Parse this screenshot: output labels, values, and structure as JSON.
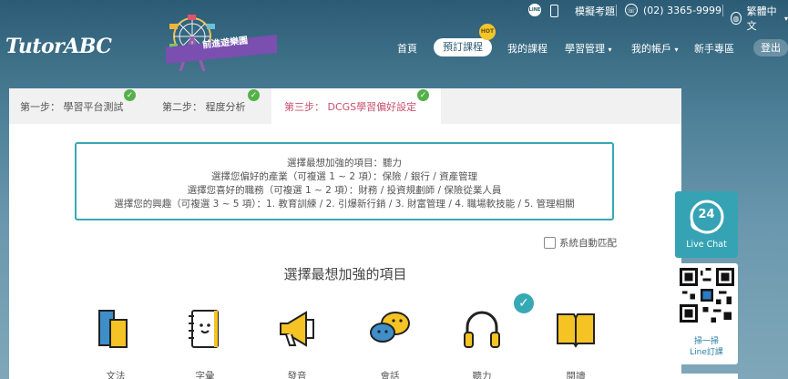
{
  "topbar": {
    "line_icon_text": "LINE",
    "exam_label": "模擬考題",
    "phone_number": "(02) 3365-9999",
    "language": "繁體中文"
  },
  "nav": {
    "logo": "TutorABC",
    "banner_text": "前進遊樂園",
    "items": [
      "首頁",
      "預訂課程",
      "我的課程",
      "學習管理",
      "我的帳戶",
      "新手專區"
    ],
    "hot_badge": "HOT",
    "login": "登出"
  },
  "steps": [
    {
      "label": "第一步： 學習平台測試",
      "done": true
    },
    {
      "label": "第二步： 程度分析",
      "done": true
    },
    {
      "label": "第三步： DCGS學習偏好設定",
      "done": true,
      "active": true
    }
  ],
  "summary": {
    "line1": "選擇最想加強的項目：聽力",
    "line2": "選擇您偏好的產業（可複選 1 ~ 2 項）：保險 / 銀行 / 資產管理",
    "line3": "選擇您喜好的職務（可複選 1 ~ 2 項）：財務 / 投資規劃師 / 保險從業人員",
    "line4": "選擇您的興趣（可複選 3 ~ 5 項）：1. 教育訓練 / 2. 引爆新行銷 / 3. 財富管理 / 4. 職場軟技能 / 5. 管理相關"
  },
  "auto_match_label": "系統自動匹配",
  "section_title": "選擇最想加強的項目",
  "skills": [
    {
      "label": "文法",
      "icon": "books-icon"
    },
    {
      "label": "字彙",
      "icon": "notebook-icon"
    },
    {
      "label": "發音",
      "icon": "megaphone-icon"
    },
    {
      "label": "會話",
      "icon": "chat-bubbles-icon"
    },
    {
      "label": "聽力",
      "icon": "headphones-icon",
      "selected": true
    },
    {
      "label": "閱讀",
      "icon": "open-book-icon"
    }
  ],
  "livechat": {
    "badge": "24",
    "label": "Live Chat"
  },
  "line_sub": {
    "line1": "掃一掃",
    "line2": "Line訂課"
  },
  "colors": {
    "accent": "#36a9b4",
    "active_step": "#c8506d",
    "check": "#55b04a",
    "header_bg": "#2c5c75"
  }
}
